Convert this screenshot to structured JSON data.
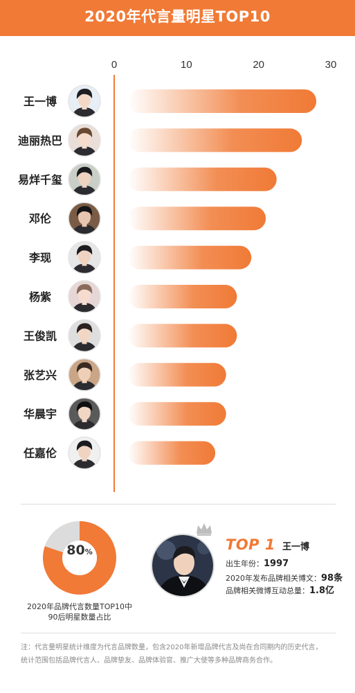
{
  "header": {
    "title": "2020年代言量明星TOP10"
  },
  "chart_data": {
    "type": "bar",
    "orientation": "horizontal",
    "title": "2020年代言量明星TOP10",
    "categories": [
      "王一博",
      "迪丽热巴",
      "易烊千玺",
      "邓伦",
      "李现",
      "杨紫",
      "王俊凯",
      "张艺兴",
      "华晨宇",
      "任嘉伦"
    ],
    "values": [
      28,
      26,
      22.5,
      21,
      19,
      17,
      17,
      15.5,
      15.5,
      14
    ],
    "xlim": [
      0,
      30
    ],
    "x_ticks": [
      "0",
      "10",
      "20",
      "30"
    ],
    "grid": false,
    "bar_color": "#f07a36"
  },
  "summary": {
    "donut_value": "80",
    "donut_percent": 0.8,
    "donut_unit": "%",
    "donut_label_line1": "2020年品牌代言数量TOP10中",
    "donut_label_line2": "90后明星数量占比",
    "top_badge": "TOP 1",
    "top_name": "王一博",
    "birth_label": "出生年份：",
    "birth_value": "1997",
    "posts_label": "2020年发布品牌相关博文：",
    "posts_value": "98条",
    "interact_label": "品牌相关微博互动总量：",
    "interact_value": "1.8亿"
  },
  "note": {
    "line1": "注：代言量明星统计维度为代言品牌数量，包含2020年新增品牌代言及尚在合同期内的历史代言，",
    "line2": "统计范围包括品牌代言人、品牌挚友、品牌体验官、推广大使等多种品牌商务合作。"
  },
  "colors": {
    "accent": "#f07a36",
    "donut_track": "#dcdcdc"
  }
}
